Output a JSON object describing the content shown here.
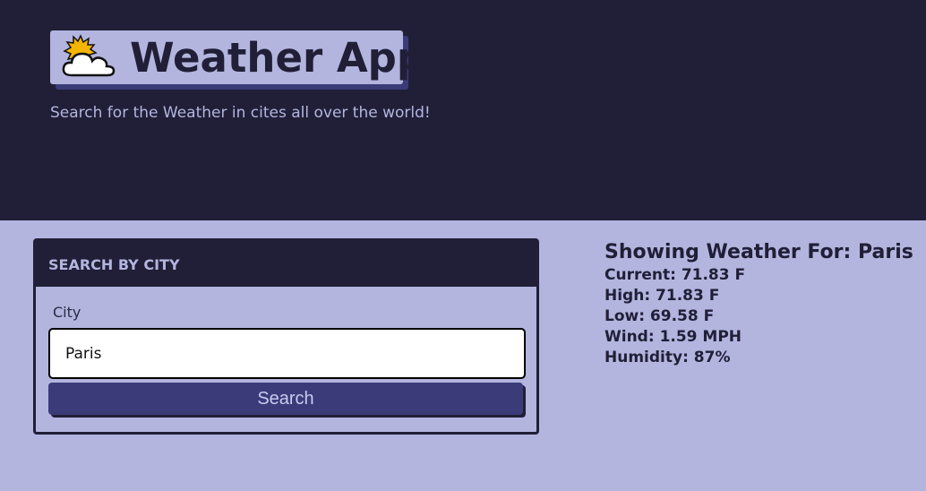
{
  "header": {
    "title": "Weather App",
    "subtitle": "Search for the Weather in cites all over the world!",
    "icon": "sun-behind-cloud-icon"
  },
  "search": {
    "heading": "SEARCH BY CITY",
    "city_label": "City",
    "city_value": "Paris",
    "button_label": "Search"
  },
  "results": {
    "title": "Showing Weather For: Paris",
    "current": "Current: 71.83 F",
    "high": "High: 71.83 F",
    "low": "Low: 69.58 F",
    "wind": "Wind: 1.59 MPH",
    "humidity": "Humidity: 87%"
  },
  "colors": {
    "dark": "#201f37",
    "light": "#b3b5df",
    "accent": "#3b3b7a"
  }
}
